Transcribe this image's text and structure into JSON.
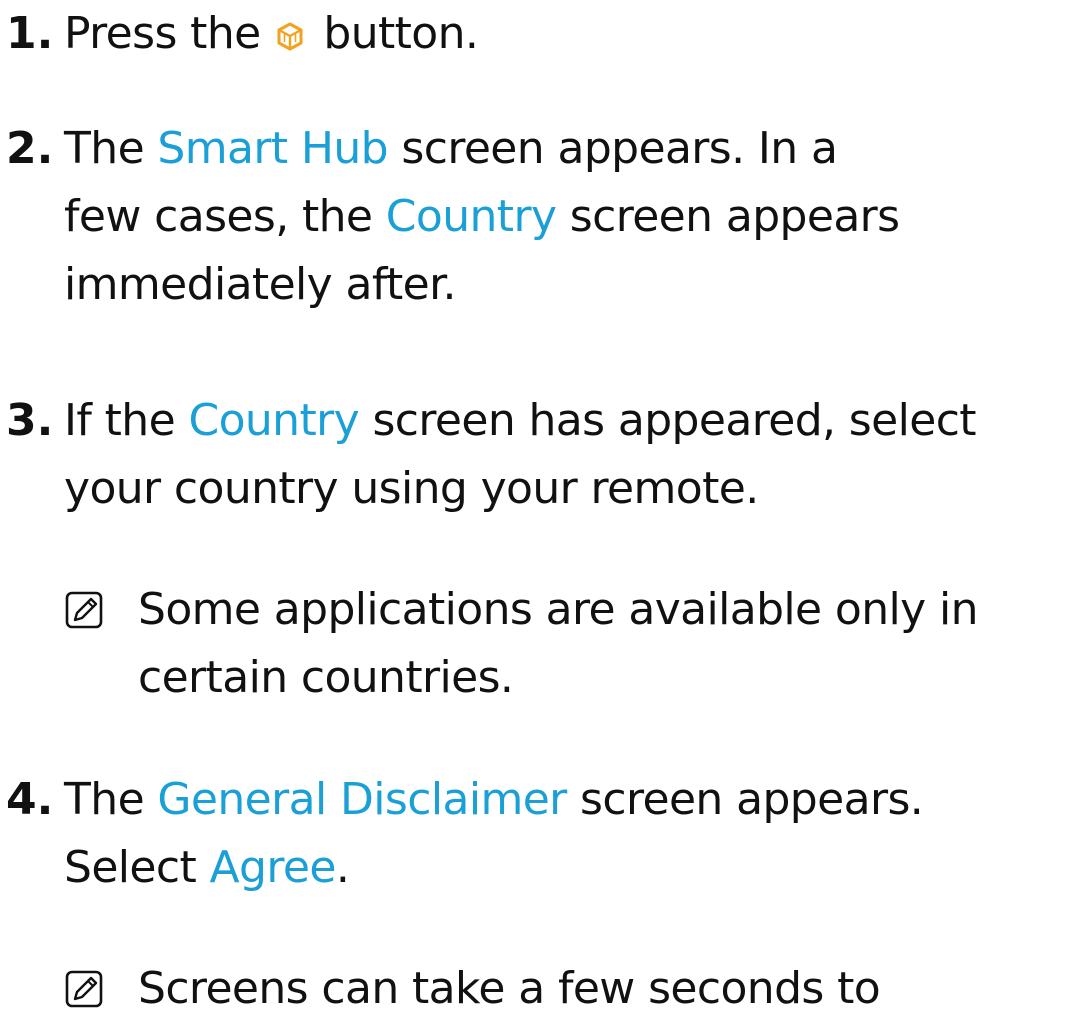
{
  "steps": [
    {
      "number": "1.",
      "lines": [
        {
          "before": "Press the ",
          "after": " button."
        }
      ],
      "icon": "smart-hub-cube-icon"
    },
    {
      "number": "2.",
      "line1_a": "The ",
      "line1_hl": "Smart Hub",
      "line1_b": " screen appears. In a",
      "line2_a": "few cases, the ",
      "line2_hl": "Country",
      "line2_b": " screen appears",
      "line3": "immediately after."
    },
    {
      "number": "3.",
      "line1_a": "If the ",
      "line1_hl": "Country",
      "line1_b": " screen has appeared, select",
      "line2": "your country using your remote.",
      "note_line1": "Some applications are available only in",
      "note_line2": "certain countries."
    },
    {
      "number": "4.",
      "line1_a": "The ",
      "line1_hl": "General Disclaimer",
      "line1_b": " screen appears.",
      "line2_a": "Select ",
      "line2_hl": "Agree",
      "line2_b": ".",
      "note_line1": "Screens can take a few seconds to"
    }
  ],
  "colors": {
    "highlight": "#1a9fd6",
    "icon_accent": "#f2a21e",
    "text": "#111111"
  },
  "icons": {
    "note": "note-pencil-icon",
    "button": "smart-hub-cube-icon"
  }
}
